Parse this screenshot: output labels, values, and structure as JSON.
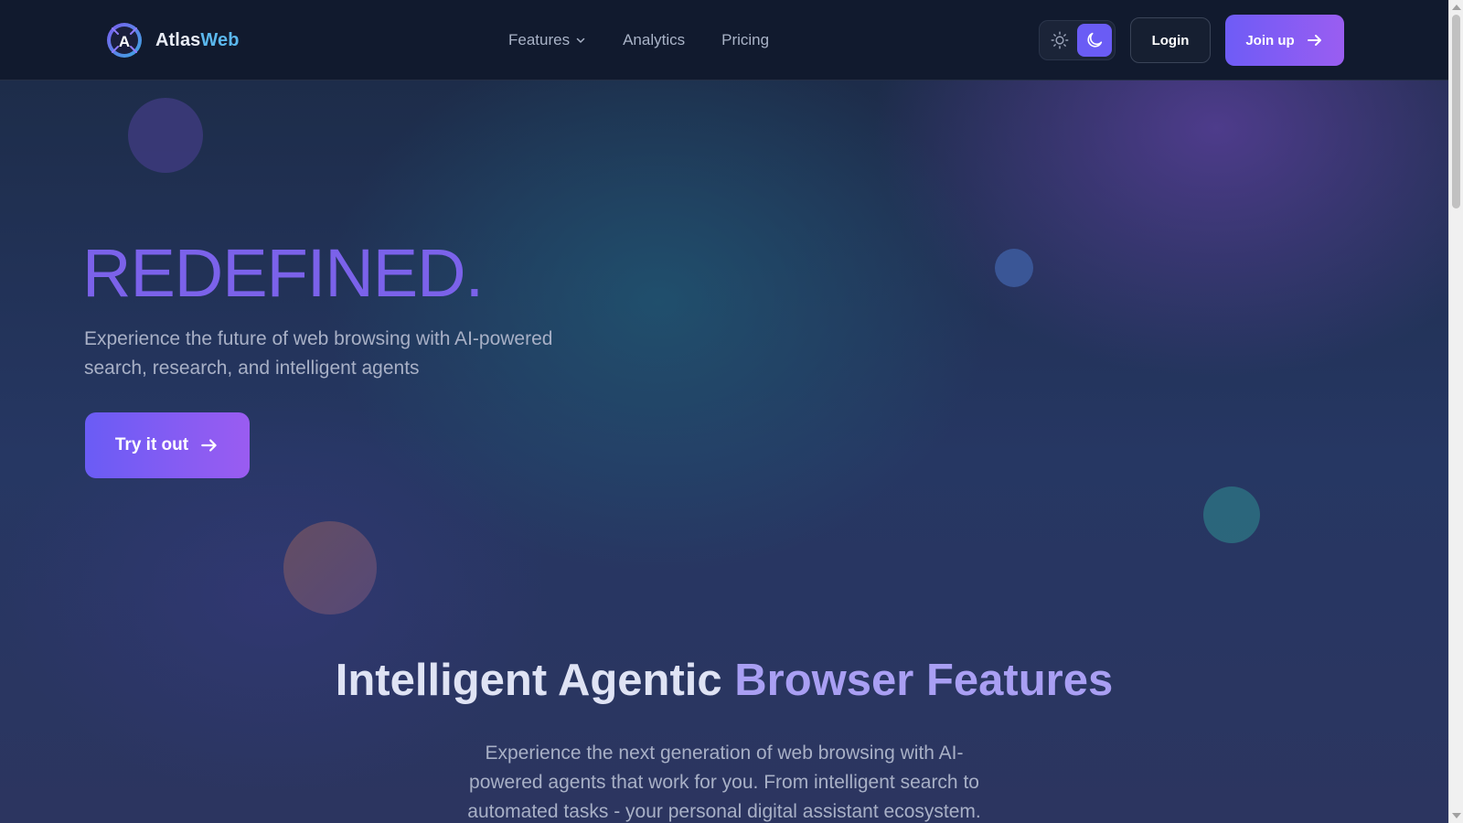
{
  "brand": {
    "name_part1": "Atlas",
    "name_part2": "Web",
    "logo_letter": "A",
    "colors": {
      "primary": "#6e5cf6",
      "accent": "#5bb8ee",
      "background": "#111a2e"
    }
  },
  "nav": {
    "items": [
      {
        "label": "Features",
        "icon": "chevron-down-icon"
      },
      {
        "label": "Analytics"
      },
      {
        "label": "Pricing"
      }
    ]
  },
  "header_actions": {
    "theme_toggle": {
      "light_icon": "sun-icon",
      "dark_icon": "moon-icon",
      "active": "dark"
    },
    "login_label": "Login",
    "join_label": "Join up",
    "join_icon": "arrow-right-icon"
  },
  "hero": {
    "title": "REDEFINED.",
    "subtitle": "Experience the future of web browsing with AI-powered search, research, and intelligent agents",
    "cta_label": "Try it out",
    "cta_icon": "arrow-right-icon"
  },
  "features": {
    "title_part1": "Intelligent Agentic",
    "title_part2": "Browser Features",
    "description": "Experience the next generation of web browsing with AI-powered agents that work for you. From intelligent search to automated tasks - your personal digital assistant ecosystem."
  }
}
